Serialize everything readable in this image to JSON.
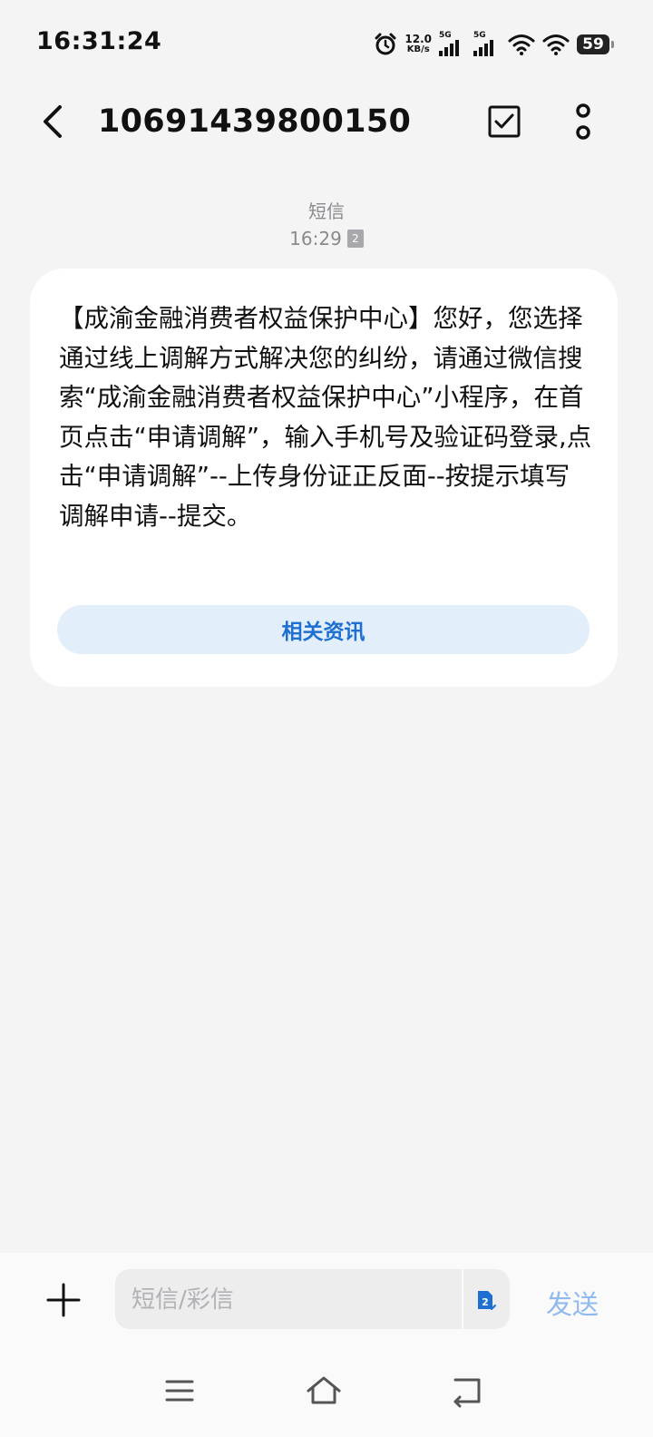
{
  "status_bar": {
    "time": "16:31:24",
    "net_speed_value": "12.0",
    "net_speed_unit": "KB/s",
    "sim1_label": "5G",
    "sim2_label": "5G",
    "battery": "59",
    "icons": [
      "alarm-icon",
      "signal-icon",
      "signal-icon",
      "wifi-icon",
      "wifi-icon",
      "battery-icon"
    ]
  },
  "header": {
    "title": "10691439800150",
    "icons": [
      "back-arrow-icon",
      "checkbox-icon",
      "more-vertical-icon"
    ]
  },
  "conversation": {
    "channel_label": "短信",
    "timestamp": "16:29",
    "sim_badge": "2"
  },
  "message": {
    "text": "【成渝金融消费者权益保护中心】您好，您选择通过线上调解方式解决您的纠纷，请通过微信搜索“成渝金融消费者权益保护中心”小程序，在首页点击“申请调解”，输入手机号及验证码登录,点击“申请调解”--上传身份证正反面--按提示填写调解申请--提交。",
    "related_button_label": "相关资讯"
  },
  "composer": {
    "placeholder": "短信/彩信",
    "sim_label": "2",
    "send_label": "发送",
    "icons": [
      "plus-icon",
      "sim-card-icon"
    ]
  },
  "nav_bar": {
    "icons": [
      "menu-icon",
      "home-icon",
      "back-icon"
    ]
  },
  "colors": {
    "background": "#f4f4f5",
    "accent": "#1e6fd2",
    "send_disabled": "#8fbaf0",
    "related_bg": "#e3eefb"
  }
}
